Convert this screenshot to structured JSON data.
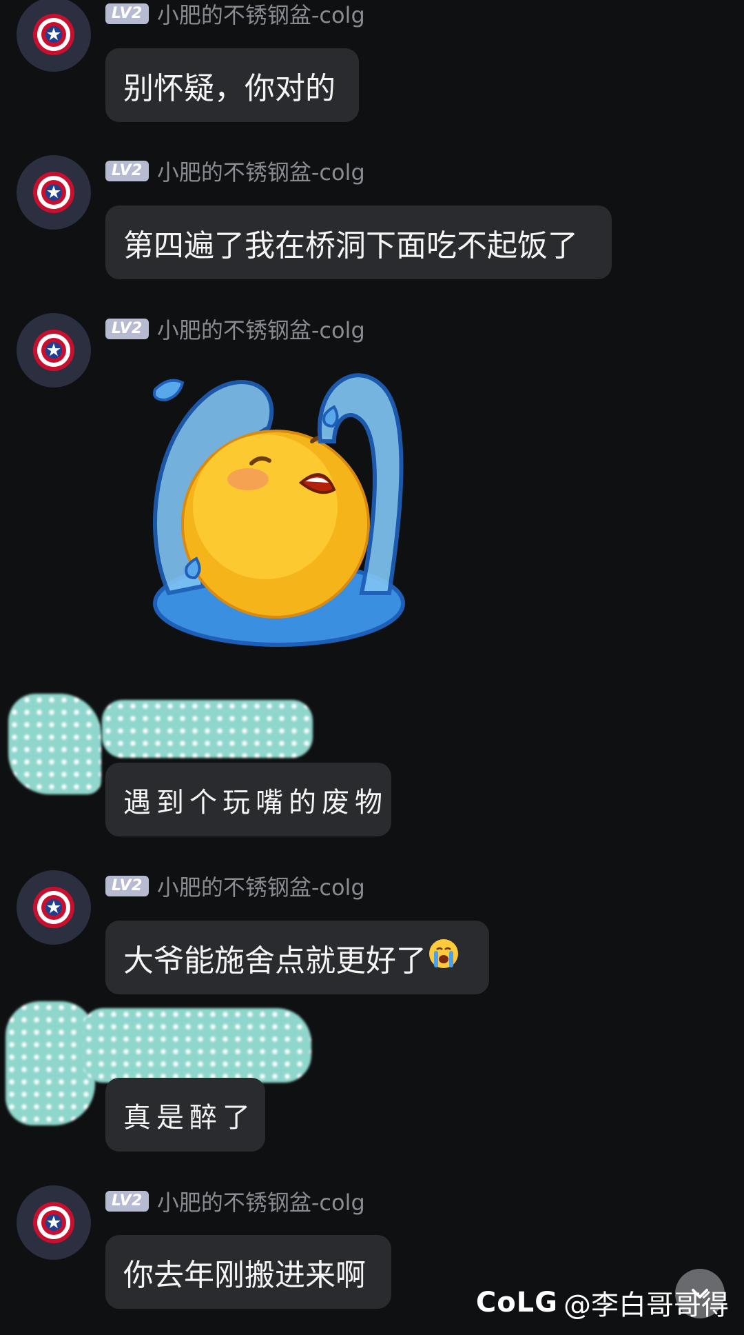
{
  "messages": [
    {
      "user": "小肥的不锈钢盆-colg",
      "level": "LV2",
      "text": "别怀疑，你对的"
    },
    {
      "user": "小肥的不锈钢盆-colg",
      "level": "LV2",
      "text": "第四遍了我在桥洞下面吃不起饭了"
    },
    {
      "user": "小肥的不锈钢盆-colg",
      "level": "LV2",
      "sticker": "crying-emoji-sticker"
    },
    {
      "user": "",
      "level": "",
      "text": "遇到个玩嘴的废物",
      "redacted": true
    },
    {
      "user": "小肥的不锈钢盆-colg",
      "level": "LV2",
      "text": "大爷能施舍点就更好了",
      "emoji": "loudly-crying-emoji"
    },
    {
      "user": "",
      "level": "",
      "text": "真是醉了",
      "redacted": true
    },
    {
      "user": "小肥的不锈钢盆-colg",
      "level": "LV2",
      "text": "你去年刚搬进来啊"
    }
  ],
  "watermark": {
    "logo": "CoLG",
    "handle": "@李白哥哥得"
  },
  "colors": {
    "background": "#0f1012",
    "bubble": "#2a2b2e",
    "username": "#8a8c92",
    "badge": "#b7bbd1",
    "redaction": "#8fd6cc"
  },
  "icons": {
    "avatar": "captain-shield-icon",
    "scroll": "chevron-down-icon"
  }
}
